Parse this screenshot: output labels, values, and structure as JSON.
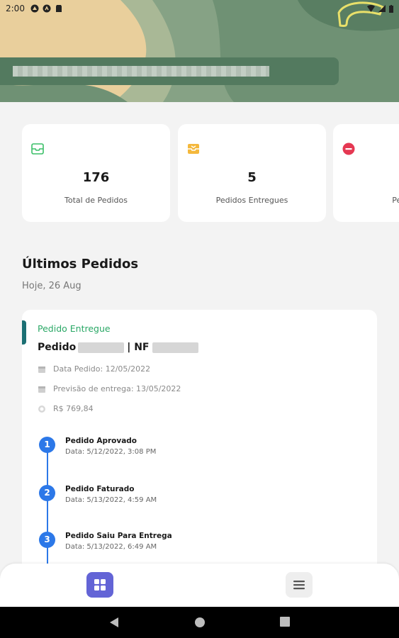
{
  "status_bar": {
    "time": "2:00"
  },
  "colors": {
    "accent": "#6364d6",
    "timeline": "#2c78e8",
    "delivered": "#2aa866",
    "header_green": "#537a5f"
  },
  "stats": [
    {
      "icon": "inbox-icon",
      "value": "176",
      "label": "Total de Pedidos"
    },
    {
      "icon": "inbox-delivered-icon",
      "value": "5",
      "label": "Pedidos Entregues"
    },
    {
      "icon": "minus-circle-icon",
      "value": "",
      "label": "Pedidos"
    }
  ],
  "recent": {
    "title": "Últimos Pedidos",
    "date": "Hoje, 26 Aug"
  },
  "order": {
    "status": "Pedido Entregue",
    "title_prefix": "Pedido",
    "title_middle": "| NF",
    "data_pedido": "Data Pedido: 12/05/2022",
    "previsao": "Previsão de entrega: 13/05/2022",
    "valor": "R$ 769,84",
    "steps": [
      {
        "num": "1",
        "title": "Pedido Aprovado",
        "date": "Data: 5/12/2022, 3:08 PM"
      },
      {
        "num": "2",
        "title": "Pedido Faturado",
        "date": "Data: 5/13/2022, 4:59 AM"
      },
      {
        "num": "3",
        "title": "Pedido Saiu Para Entrega",
        "date": "Data: 5/13/2022, 6:49 AM"
      }
    ]
  },
  "nav": {
    "home_icon": "grid-icon",
    "menu_icon": "menu-icon"
  }
}
